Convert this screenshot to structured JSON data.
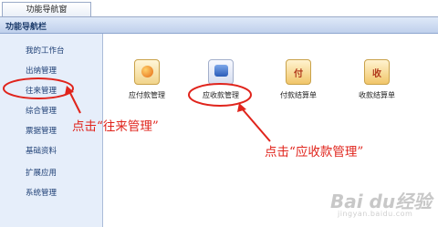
{
  "tabs": [
    {
      "label": "功能导航窗"
    }
  ],
  "title": "功能导航栏",
  "sidebar": {
    "items": [
      {
        "label": "我的工作台"
      },
      {
        "label": "出纳管理"
      },
      {
        "label": "往来管理"
      },
      {
        "label": "综合管理"
      },
      {
        "label": "票据管理"
      },
      {
        "label": "基础资料"
      },
      {
        "label": "扩展应用"
      },
      {
        "label": "系统管理"
      }
    ],
    "selected": "往来管理"
  },
  "apps": [
    {
      "label": "应付款管理",
      "icon": "pay-disc-icon"
    },
    {
      "label": "应收款管理",
      "icon": "receivable-icon"
    },
    {
      "label": "付款结算单",
      "icon": "fu-icon",
      "glyph": "付"
    },
    {
      "label": "收款结算单",
      "icon": "shou-icon",
      "glyph": "收"
    }
  ],
  "annotations": {
    "click_wanglai": "点击“往来管理”",
    "click_yingshou": "点击“应收款管理”"
  },
  "watermark": {
    "brand": "Bai du经验",
    "url": "jingyan.baidu.com"
  },
  "colors": {
    "annotation": "#e0241c",
    "sidebar_bg": "#e6eefa",
    "title_text": "#1a3a6a"
  }
}
